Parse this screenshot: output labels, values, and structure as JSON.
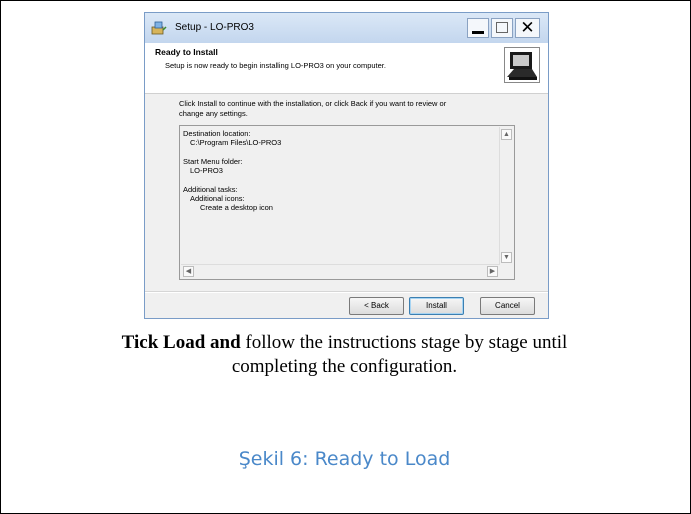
{
  "dialog": {
    "title": "Setup - LO-PRO3",
    "header_title": "Ready to Install",
    "header_subtitle": "Setup is now ready to begin installing LO-PRO3 on your computer.",
    "intro_line1": "Click Install to continue with the installation, or click Back if you want to review or",
    "intro_line2": "change any settings.",
    "memo": {
      "dest_label": "Destination location:",
      "dest_value": "C:\\Program Files\\LO-PRO3",
      "menu_label": "Start Menu folder:",
      "menu_value": "LO-PRO3",
      "tasks_label": "Additional tasks:",
      "tasks_group": "Additional icons:",
      "tasks_item": "Create a desktop icon"
    },
    "buttons": {
      "back": "< Back",
      "install": "Install",
      "cancel": "Cancel"
    }
  },
  "document": {
    "instruction_bold": "Tick  Load and",
    "instruction_rest_line1": " follow the instructions stage by stage until",
    "instruction_line2": "completing the configuration.",
    "figure_caption": "Şekil 6: Ready to Load"
  }
}
